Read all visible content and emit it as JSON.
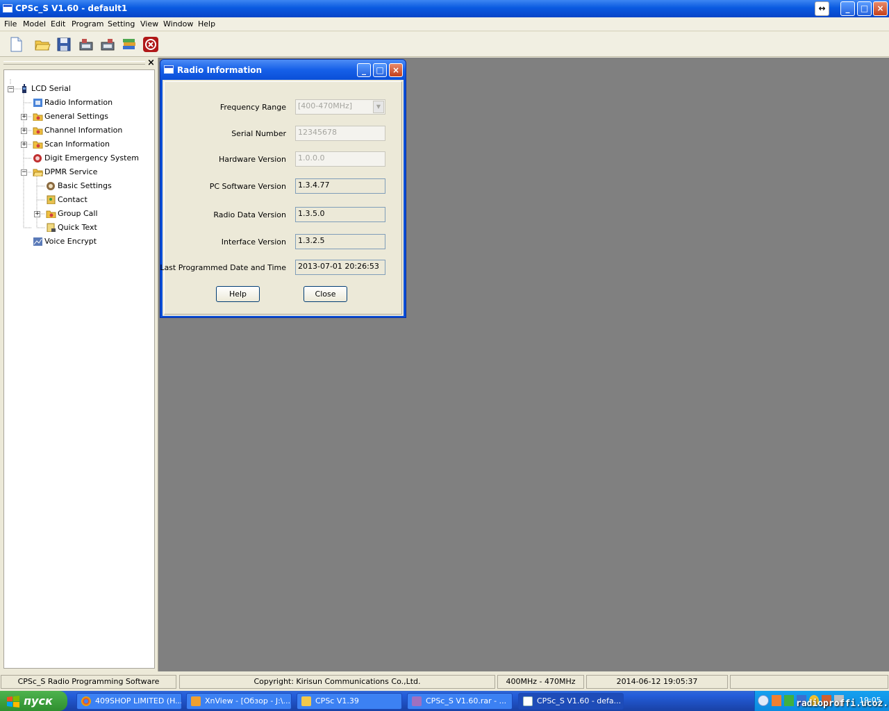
{
  "window": {
    "title": "CPSc_S V1.60 - default1"
  },
  "menu": [
    "File",
    "Model",
    "Edit",
    "Program",
    "Setting",
    "View",
    "Window",
    "Help"
  ],
  "toolbar": {
    "icons": [
      "new-file-icon",
      "open-folder-icon",
      "save-icon",
      "read-from-radio-icon",
      "write-to-radio-icon",
      "books-icon",
      "stop-icon"
    ]
  },
  "tree": {
    "close_glyph": "×",
    "items": [
      {
        "label": "LCD Serial",
        "icon": "radio-icon"
      },
      {
        "label": "Radio Information",
        "icon": "radio-info-icon"
      },
      {
        "label": "General Settings",
        "icon": "folder-icon"
      },
      {
        "label": "Channel Information",
        "icon": "folder-icon"
      },
      {
        "label": "Scan Information",
        "icon": "folder-icon"
      },
      {
        "label": "Digit Emergency System",
        "icon": "emergency-icon"
      },
      {
        "label": "DPMR Service",
        "icon": "open-folder-icon"
      },
      {
        "label": "Basic Settings",
        "icon": "settings-icon"
      },
      {
        "label": "Contact",
        "icon": "contact-icon"
      },
      {
        "label": "Group Call",
        "icon": "folder-icon"
      },
      {
        "label": "Quick Text",
        "icon": "quick-text-icon"
      },
      {
        "label": "Voice Encrypt",
        "icon": "voice-encrypt-icon"
      }
    ]
  },
  "dialog": {
    "title": "Radio Information",
    "fields": [
      {
        "label": "Frequency Range",
        "value": "[400-470MHz]"
      },
      {
        "label": "Serial Number",
        "value": "12345678"
      },
      {
        "label": "Hardware Version",
        "value": "1.0.0.0"
      },
      {
        "label": "PC Software Version",
        "value": "1.3.4.77"
      },
      {
        "label": "Radio Data Version",
        "value": "1.3.5.0"
      },
      {
        "label": "Interface Version",
        "value": "1.3.2.5"
      },
      {
        "label": "Last Programmed Date and Time",
        "value": "2013-07-01 20:26:53"
      }
    ],
    "help_label": "Help",
    "close_label": "Close"
  },
  "status": {
    "app": "CPSc_S Radio Programming Software",
    "copyright": "Copyright:  Kirisun Communications Co.,Ltd.",
    "band": "400MHz - 470MHz",
    "datetime": "2014-06-12 19:05:37"
  },
  "taskbar": {
    "start_label": "пуск",
    "tasks": [
      {
        "label": "409SHOP LIMITED (H...",
        "icon": "chrome-icon"
      },
      {
        "label": "XnView - [Обзор - J:\\...",
        "icon": "xnview-icon"
      },
      {
        "label": "CPSc V1.39",
        "icon": "folder-icon"
      },
      {
        "label": "CPSc_S V1.60.rar - ...",
        "icon": "archive-icon"
      },
      {
        "label": "CPSc_S V1.60 - defa...",
        "icon": "app-icon"
      }
    ],
    "clock": "19:05"
  },
  "watermark": "radioproffi.ucoz.ua",
  "colors": {
    "titlebar": "#0a5ae0",
    "mdi_background": "#808080",
    "taskbar": "#245edb",
    "start": "#3c9a3c"
  }
}
